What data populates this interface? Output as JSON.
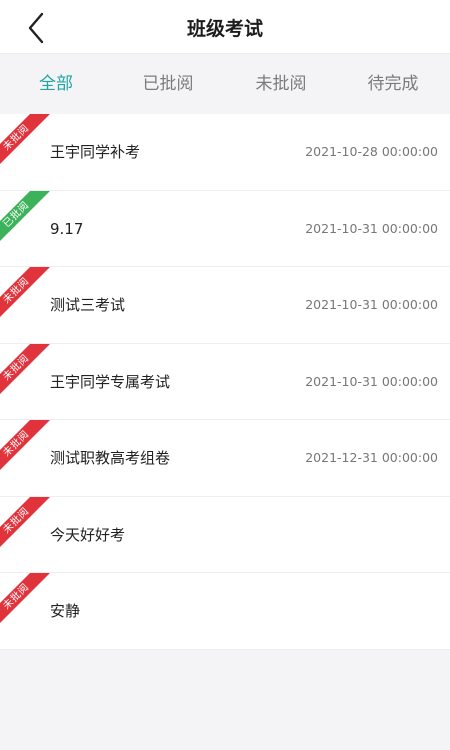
{
  "header": {
    "title": "班级考试",
    "back_icon": "chevron-left-icon"
  },
  "tabs": [
    {
      "label": "全部",
      "active": true
    },
    {
      "label": "已批阅",
      "active": false
    },
    {
      "label": "未批阅",
      "active": false
    },
    {
      "label": "待完成",
      "active": false
    }
  ],
  "colors": {
    "accent": "#22a5a0",
    "unreviewed": "#e0333c",
    "reviewed": "#3cb35a"
  },
  "exams": [
    {
      "status": "未批阅",
      "status_type": "unreviewed",
      "name": "王宇同学补考",
      "date": "2021-10-28 00:00:00"
    },
    {
      "status": "已批阅",
      "status_type": "reviewed",
      "name": "9.17",
      "date": "2021-10-31 00:00:00"
    },
    {
      "status": "未批阅",
      "status_type": "unreviewed",
      "name": "测试三考试",
      "date": "2021-10-31 00:00:00"
    },
    {
      "status": "未批阅",
      "status_type": "unreviewed",
      "name": "王宇同学专属考试",
      "date": "2021-10-31 00:00:00"
    },
    {
      "status": "未批阅",
      "status_type": "unreviewed",
      "name": "测试职教高考组卷",
      "date": "2021-12-31 00:00:00"
    },
    {
      "status": "未批阅",
      "status_type": "unreviewed",
      "name": "今天好好考",
      "date": ""
    },
    {
      "status": "未批阅",
      "status_type": "unreviewed",
      "name": "安静",
      "date": ""
    }
  ]
}
